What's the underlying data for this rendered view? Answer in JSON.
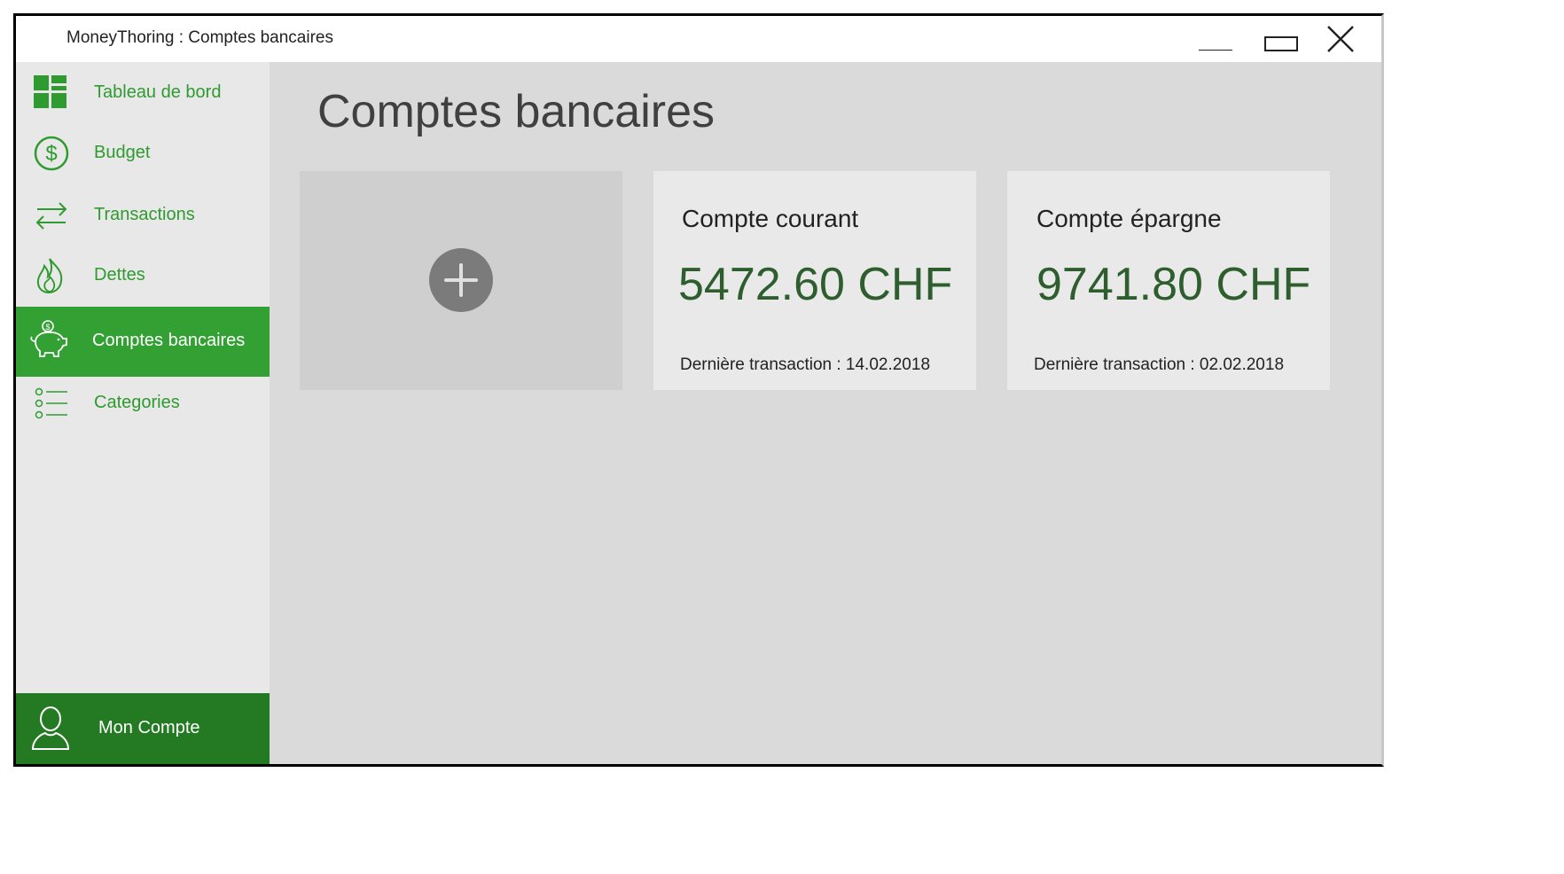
{
  "window": {
    "title": "MoneyThoring : Comptes bancaires"
  },
  "sidebar": {
    "items": [
      {
        "label": "Tableau de bord",
        "icon": "dashboard-icon",
        "active": false
      },
      {
        "label": "Budget",
        "icon": "dollar-circle-icon",
        "active": false
      },
      {
        "label": "Transactions",
        "icon": "transfer-arrows-icon",
        "active": false
      },
      {
        "label": "Dettes",
        "icon": "flame-icon",
        "active": false
      },
      {
        "label": "Comptes bancaires",
        "icon": "piggy-bank-icon",
        "active": true
      },
      {
        "label": "Categories",
        "icon": "list-icon",
        "active": false
      }
    ],
    "account_label": "Mon Compte",
    "account_icon": "user-icon"
  },
  "main": {
    "title": "Comptes bancaires",
    "add_card_icon": "plus-icon",
    "accounts": [
      {
        "name": "Compte courant",
        "amount": "5472.60 CHF",
        "last_transaction": "Dernière transaction : 14.02.2018"
      },
      {
        "name": "Compte épargne",
        "amount": "9741.80 CHF",
        "last_transaction": "Dernière transaction : 02.02.2018"
      }
    ]
  },
  "colors": {
    "accent_green": "#33a033",
    "dark_green": "#237a23",
    "amount_green": "#2e5e2e",
    "sidebar_bg": "#e8e8e8",
    "content_bg": "#dadada"
  }
}
